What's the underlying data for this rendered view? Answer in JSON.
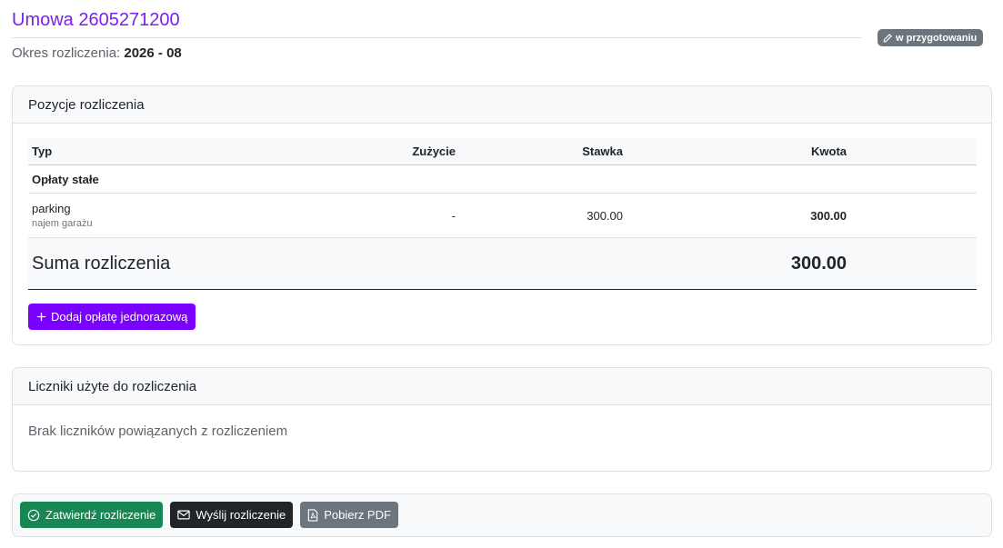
{
  "header": {
    "title": "Umowa 2605271200",
    "period_label": "Okres rozliczenia:",
    "period_value": "2026 - 08",
    "status": {
      "label": "w przygotowaniu",
      "icon": "pencil-icon",
      "color": "#6c757d"
    }
  },
  "positions": {
    "title": "Pozycje rozliczenia",
    "columns": {
      "type": "Typ",
      "usage": "Zużycie",
      "rate": "Stawka",
      "amount": "Kwota"
    },
    "group": "Opłaty stałe",
    "items": [
      {
        "name": "parking",
        "description": "najem garażu",
        "usage": "-",
        "rate": "300.00",
        "amount": "300.00"
      }
    ],
    "sum": {
      "label": "Suma rozliczenia",
      "value": "300.00"
    },
    "add_button": {
      "label": "Dodaj opłatę jednorazową",
      "icon": "plus-icon",
      "color": "#7a00ff"
    }
  },
  "meters": {
    "title": "Liczniki użyte do rozliczenia",
    "empty_text": "Brak liczników powiązanych z rozliczeniem"
  },
  "actions": {
    "approve": {
      "label": "Zatwierdź rozliczenie",
      "icon": "check-circle-icon",
      "color": "#198754"
    },
    "send": {
      "label": "Wyślij rozliczenie",
      "icon": "envelope-icon",
      "color": "#212529"
    },
    "pdf": {
      "label": "Pobierz PDF",
      "icon": "pdf-file-icon",
      "color": "#6c757d"
    }
  },
  "accent_color": "#7a1ff0"
}
